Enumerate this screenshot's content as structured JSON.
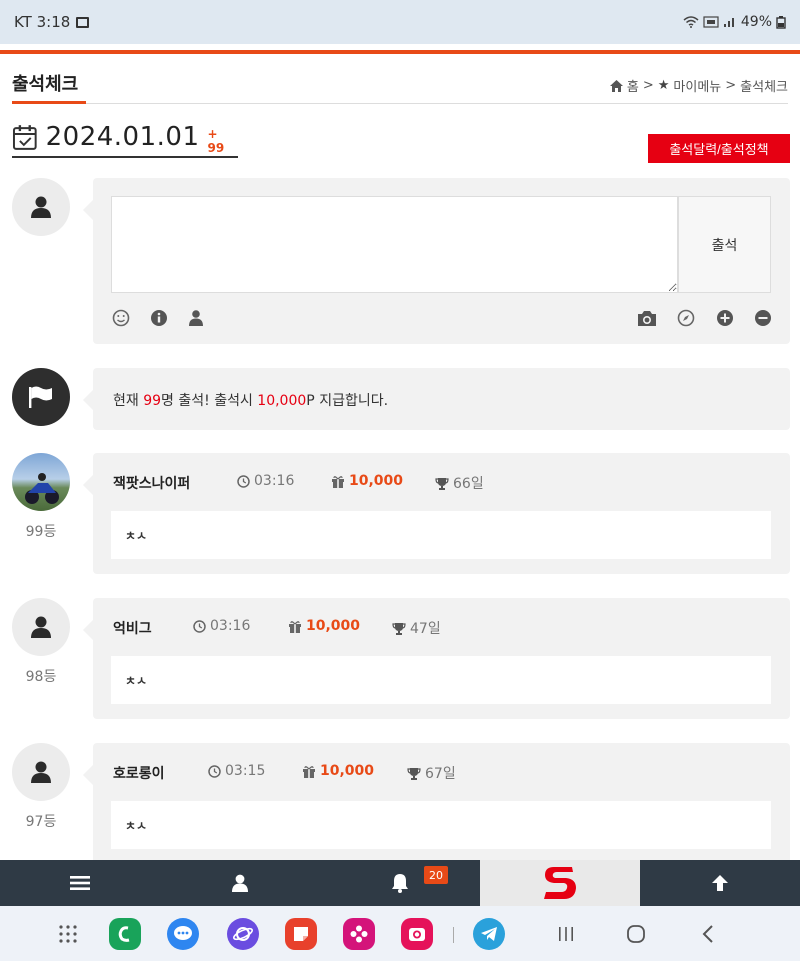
{
  "status": {
    "carrier_time": "KT 3:18",
    "battery": "49%"
  },
  "header": {
    "title": "출석체크",
    "breadcrumb": {
      "home": "홈",
      "sep": ">",
      "mymenu": "마이메뉴",
      "current": "출석체크"
    }
  },
  "date": {
    "value": "2024.01.01",
    "plus": "+ 99",
    "policy_btn": "출석달력/출석정책"
  },
  "compose": {
    "submit": "출석"
  },
  "notice": {
    "p1": "현재 ",
    "count": "99",
    "p2": "명 출석! 출석시 ",
    "points": "10,000",
    "p3": "P 지급합니다."
  },
  "entries": [
    {
      "nick": "잭팟스나이퍼",
      "time": "03:16",
      "points": "10,000",
      "days": "66일",
      "rank": "99등",
      "message": "ㅊㅅ"
    },
    {
      "nick": "억비그",
      "time": "03:16",
      "points": "10,000",
      "days": "47일",
      "rank": "98등",
      "message": "ㅊㅅ"
    },
    {
      "nick": "호로롱이",
      "time": "03:15",
      "points": "10,000",
      "days": "67일",
      "rank": "97등",
      "message": "ㅊㅅ"
    }
  ],
  "bottom_nav": {
    "badge": "20"
  },
  "colors": {
    "accent": "#e84a17",
    "red": "#e60012",
    "nav_bg": "#2f3a45"
  }
}
